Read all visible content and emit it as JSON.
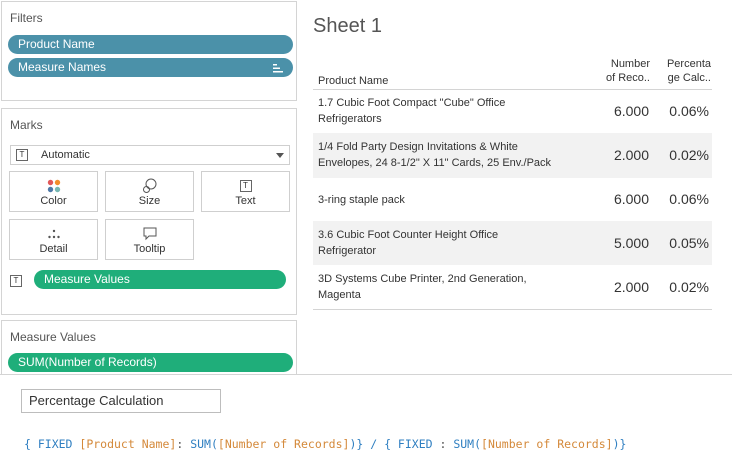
{
  "filters": {
    "title": "Filters",
    "pills": [
      {
        "label": "Product Name"
      },
      {
        "label": "Measure Names"
      }
    ]
  },
  "marks": {
    "title": "Marks",
    "type_select": {
      "value": "Automatic",
      "icon": "text-mark-icon"
    },
    "buttons": [
      {
        "label": "Color",
        "icon": "color-icon"
      },
      {
        "label": "Size",
        "icon": "size-icon"
      },
      {
        "label": "Text",
        "icon": "text-icon"
      },
      {
        "label": "Detail",
        "icon": "detail-icon"
      },
      {
        "label": "Tooltip",
        "icon": "tooltip-icon"
      }
    ],
    "measure_pill": {
      "label": "Measure Values"
    }
  },
  "measure_values": {
    "title": "Measure Values",
    "pills": [
      {
        "label": "SUM(Number of Records)"
      }
    ]
  },
  "sheet": {
    "title": "Sheet 1",
    "columns": {
      "name": "Product Name",
      "c1_line1": "Number",
      "c1_line2": "of Reco..",
      "c2_line1": "Percenta",
      "c2_line2": "ge Calc.."
    },
    "rows": [
      {
        "line1": "1.7 Cubic Foot Compact \"Cube\" Office",
        "line2": "Refrigerators",
        "number": "6.000",
        "percent": "0.06%"
      },
      {
        "line1": "1/4 Fold Party Design Invitations & White",
        "line2": "Envelopes, 24 8-1/2\" X 11\" Cards, 25 Env./Pack",
        "number": "2.000",
        "percent": "0.02%"
      },
      {
        "line1": "3-ring staple pack",
        "line2": "",
        "number": "6.000",
        "percent": "0.06%"
      },
      {
        "line1": "3.6 Cubic Foot Counter Height Office",
        "line2": "Refrigerator",
        "number": "5.000",
        "percent": "0.05%"
      },
      {
        "line1": "3D Systems Cube Printer, 2nd Generation,",
        "line2": "Magenta",
        "number": "2.000",
        "percent": "0.02%"
      }
    ]
  },
  "calc_editor": {
    "name": "Percentage Calculation",
    "formula": {
      "t1": "{ FIXED ",
      "t2": "[Product Name]",
      "t3": ": ",
      "t4": "SUM(",
      "t5": "[Number of Records]",
      "t6": ")} / { ",
      "t7": "FIXED",
      "t8": " : ",
      "t9": "SUM(",
      "t10": "[Number of Records]",
      "t11": ")}"
    }
  },
  "colors": {
    "dimension_pill": "#4b91a9",
    "measure_pill": "#1fae7a",
    "row_shade": "#f2f2f2",
    "keyword": "#2f7fc1",
    "field": "#d4893a"
  }
}
